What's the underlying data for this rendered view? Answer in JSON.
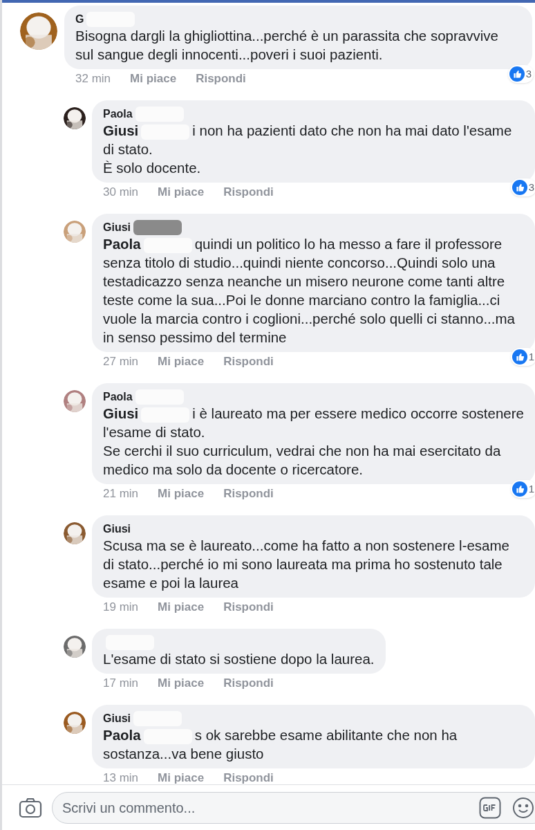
{
  "comments": [
    {
      "name": "G",
      "name_redacted": true,
      "text": "Bisogna dargli la ghigliottina...perché è un parassita che sopravvive sul sangue degli innocenti...poveri i suoi pazienti.",
      "time": "32 min",
      "like": "Mi piace",
      "reply": "Rispondi",
      "reactions": "3",
      "replies": [
        {
          "name": "Paola",
          "name_redacted": true,
          "mention": "Giusi",
          "mention_redacted": true,
          "text": "i non ha pazienti dato che non ha mai dato l'esame di stato.\nÈ solo docente.",
          "time": "30 min",
          "like": "Mi piace",
          "reply": "Rispondi",
          "reactions": "3"
        },
        {
          "name": "Giusi",
          "name_redacted": true,
          "mention": "Paola",
          "mention_redacted": true,
          "text": "quindi un politico lo ha messo a fare il professore senza titolo di studio...quindi niente concorso...Quindi solo una testadicazzo senza neanche un misero neurone come tanti altre teste come la sua...Poi le donne marciano contro la famiglia...ci vuole la marcia contro i coglioni...perché solo quelli ci stanno...ma in senso pessimo del termine",
          "time": "27 min",
          "like": "Mi piace",
          "reply": "Rispondi",
          "reactions": "1"
        },
        {
          "name": "Paola",
          "name_redacted": true,
          "mention": "Giusi",
          "mention_redacted": true,
          "text": "i è laureato ma per essere medico occorre sostenere l'esame di stato.\nSe cerchi il suo curriculum, vedrai che non ha mai esercitato da medico ma solo da docente o ricercatore.",
          "time": "21 min",
          "like": "Mi piace",
          "reply": "Rispondi",
          "reactions": "1"
        },
        {
          "name": "Giusi",
          "text": "Scusa ma se è laureato...come ha fatto a non sostenere l-esame di stato...perché io mi sono laureata ma prima ho sostenuto tale esame e poi la laurea",
          "time": "19 min",
          "like": "Mi piace",
          "reply": "Rispondi"
        },
        {
          "name_redacted": true,
          "text": "L'esame di stato si sostiene dopo la laurea.",
          "time": "17 min",
          "like": "Mi piace",
          "reply": "Rispondi"
        },
        {
          "name": "Giusi",
          "name_redacted": true,
          "mention": "Paola",
          "mention_redacted": true,
          "text": "s ok sarebbe esame abilitante che non ha sostanza...va bene giusto",
          "time": "13 min",
          "like": "Mi piace",
          "reply": "Rispondi"
        }
      ]
    }
  ],
  "composer": {
    "placeholder": "Scrivi un commento..."
  }
}
